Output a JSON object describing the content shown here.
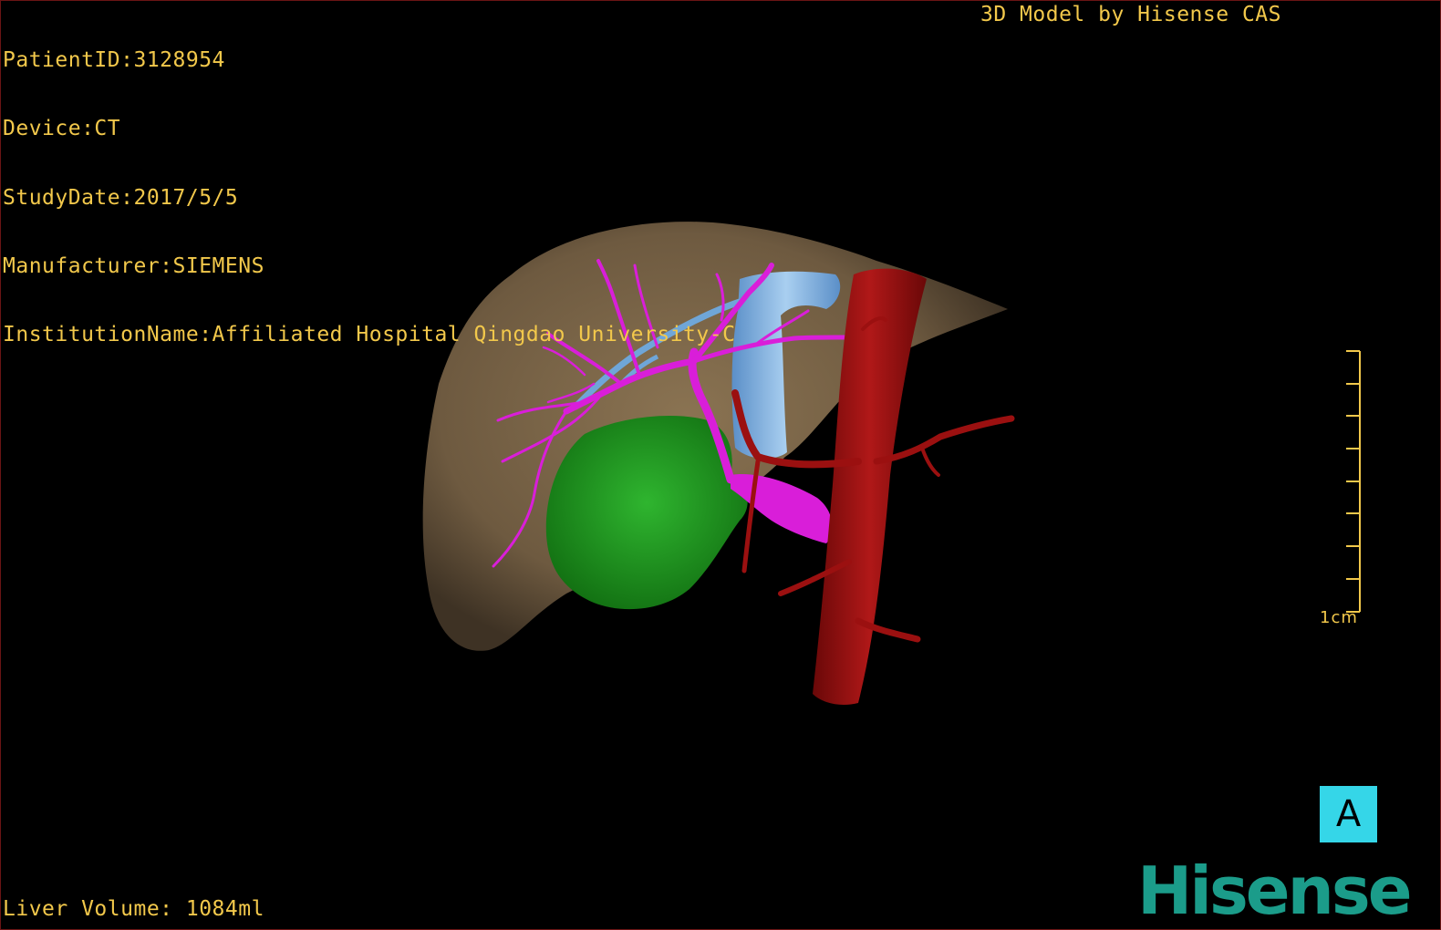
{
  "study_info": {
    "patient_id": "PatientID:3128954",
    "device": "Device:CT",
    "study_date": "StudyDate:2017/5/5",
    "manufacturer": "Manufacturer:SIEMENS",
    "institution": "InstitutionName:Affiliated Hospital Qingdao University-C"
  },
  "credit": "3D Model by Hisense CAS",
  "liver_volume": "Liver Volume: 1084ml",
  "scale_bar": {
    "label": "1cm"
  },
  "orientation_marker": {
    "label": "A"
  },
  "brand_logo": "Hisense",
  "colors": {
    "overlay_text": "#f2c84b",
    "liver": "#7a6446",
    "portal_vein": "#d91ed9",
    "hepatic_vein": "#6fa6d8",
    "artery_aorta": "#9b1010",
    "tumor": "#1f9a1f",
    "orientation_box": "#35d6e8",
    "brand": "#1b9c8a",
    "frame_border": "#6b1414"
  },
  "model_structures": [
    "liver",
    "portal-vein",
    "hepatic-vein",
    "aorta",
    "tumor"
  ]
}
